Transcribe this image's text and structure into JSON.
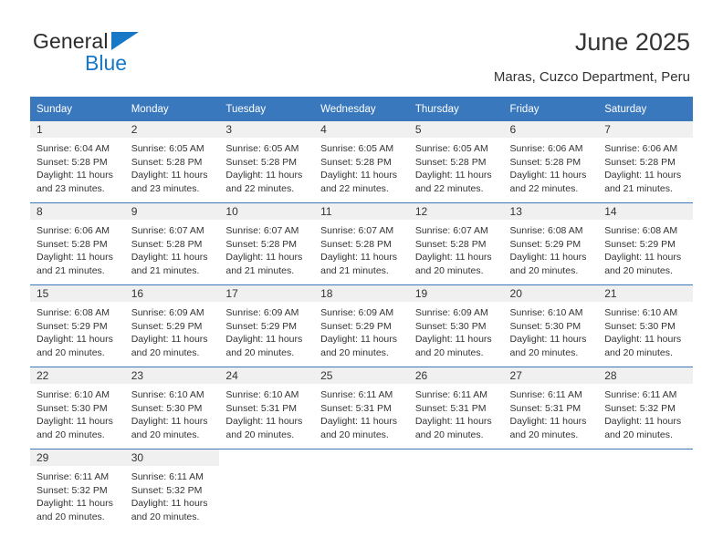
{
  "brand": {
    "name_top": "General",
    "name_bottom": "Blue",
    "color_blue": "#1878c8",
    "color_dark": "#2b2b2b",
    "triangle_icon": "triangle-logo-icon"
  },
  "header": {
    "title": "June 2025",
    "subtitle": "Maras, Cuzco Department, Peru"
  },
  "theme": {
    "header_bg": "#3a78bd",
    "header_text": "#ffffff",
    "daynum_bg": "#f0f0f0",
    "body_text": "#333333"
  },
  "calendar": {
    "weekday_headers": [
      "Sunday",
      "Monday",
      "Tuesday",
      "Wednesday",
      "Thursday",
      "Friday",
      "Saturday"
    ],
    "weeks": [
      [
        {
          "day": "1",
          "sunrise": "Sunrise: 6:04 AM",
          "sunset": "Sunset: 5:28 PM",
          "daylight_l1": "Daylight: 11 hours",
          "daylight_l2": "and 23 minutes."
        },
        {
          "day": "2",
          "sunrise": "Sunrise: 6:05 AM",
          "sunset": "Sunset: 5:28 PM",
          "daylight_l1": "Daylight: 11 hours",
          "daylight_l2": "and 23 minutes."
        },
        {
          "day": "3",
          "sunrise": "Sunrise: 6:05 AM",
          "sunset": "Sunset: 5:28 PM",
          "daylight_l1": "Daylight: 11 hours",
          "daylight_l2": "and 22 minutes."
        },
        {
          "day": "4",
          "sunrise": "Sunrise: 6:05 AM",
          "sunset": "Sunset: 5:28 PM",
          "daylight_l1": "Daylight: 11 hours",
          "daylight_l2": "and 22 minutes."
        },
        {
          "day": "5",
          "sunrise": "Sunrise: 6:05 AM",
          "sunset": "Sunset: 5:28 PM",
          "daylight_l1": "Daylight: 11 hours",
          "daylight_l2": "and 22 minutes."
        },
        {
          "day": "6",
          "sunrise": "Sunrise: 6:06 AM",
          "sunset": "Sunset: 5:28 PM",
          "daylight_l1": "Daylight: 11 hours",
          "daylight_l2": "and 22 minutes."
        },
        {
          "day": "7",
          "sunrise": "Sunrise: 6:06 AM",
          "sunset": "Sunset: 5:28 PM",
          "daylight_l1": "Daylight: 11 hours",
          "daylight_l2": "and 21 minutes."
        }
      ],
      [
        {
          "day": "8",
          "sunrise": "Sunrise: 6:06 AM",
          "sunset": "Sunset: 5:28 PM",
          "daylight_l1": "Daylight: 11 hours",
          "daylight_l2": "and 21 minutes."
        },
        {
          "day": "9",
          "sunrise": "Sunrise: 6:07 AM",
          "sunset": "Sunset: 5:28 PM",
          "daylight_l1": "Daylight: 11 hours",
          "daylight_l2": "and 21 minutes."
        },
        {
          "day": "10",
          "sunrise": "Sunrise: 6:07 AM",
          "sunset": "Sunset: 5:28 PM",
          "daylight_l1": "Daylight: 11 hours",
          "daylight_l2": "and 21 minutes."
        },
        {
          "day": "11",
          "sunrise": "Sunrise: 6:07 AM",
          "sunset": "Sunset: 5:28 PM",
          "daylight_l1": "Daylight: 11 hours",
          "daylight_l2": "and 21 minutes."
        },
        {
          "day": "12",
          "sunrise": "Sunrise: 6:07 AM",
          "sunset": "Sunset: 5:28 PM",
          "daylight_l1": "Daylight: 11 hours",
          "daylight_l2": "and 20 minutes."
        },
        {
          "day": "13",
          "sunrise": "Sunrise: 6:08 AM",
          "sunset": "Sunset: 5:29 PM",
          "daylight_l1": "Daylight: 11 hours",
          "daylight_l2": "and 20 minutes."
        },
        {
          "day": "14",
          "sunrise": "Sunrise: 6:08 AM",
          "sunset": "Sunset: 5:29 PM",
          "daylight_l1": "Daylight: 11 hours",
          "daylight_l2": "and 20 minutes."
        }
      ],
      [
        {
          "day": "15",
          "sunrise": "Sunrise: 6:08 AM",
          "sunset": "Sunset: 5:29 PM",
          "daylight_l1": "Daylight: 11 hours",
          "daylight_l2": "and 20 minutes."
        },
        {
          "day": "16",
          "sunrise": "Sunrise: 6:09 AM",
          "sunset": "Sunset: 5:29 PM",
          "daylight_l1": "Daylight: 11 hours",
          "daylight_l2": "and 20 minutes."
        },
        {
          "day": "17",
          "sunrise": "Sunrise: 6:09 AM",
          "sunset": "Sunset: 5:29 PM",
          "daylight_l1": "Daylight: 11 hours",
          "daylight_l2": "and 20 minutes."
        },
        {
          "day": "18",
          "sunrise": "Sunrise: 6:09 AM",
          "sunset": "Sunset: 5:29 PM",
          "daylight_l1": "Daylight: 11 hours",
          "daylight_l2": "and 20 minutes."
        },
        {
          "day": "19",
          "sunrise": "Sunrise: 6:09 AM",
          "sunset": "Sunset: 5:30 PM",
          "daylight_l1": "Daylight: 11 hours",
          "daylight_l2": "and 20 minutes."
        },
        {
          "day": "20",
          "sunrise": "Sunrise: 6:10 AM",
          "sunset": "Sunset: 5:30 PM",
          "daylight_l1": "Daylight: 11 hours",
          "daylight_l2": "and 20 minutes."
        },
        {
          "day": "21",
          "sunrise": "Sunrise: 6:10 AM",
          "sunset": "Sunset: 5:30 PM",
          "daylight_l1": "Daylight: 11 hours",
          "daylight_l2": "and 20 minutes."
        }
      ],
      [
        {
          "day": "22",
          "sunrise": "Sunrise: 6:10 AM",
          "sunset": "Sunset: 5:30 PM",
          "daylight_l1": "Daylight: 11 hours",
          "daylight_l2": "and 20 minutes."
        },
        {
          "day": "23",
          "sunrise": "Sunrise: 6:10 AM",
          "sunset": "Sunset: 5:30 PM",
          "daylight_l1": "Daylight: 11 hours",
          "daylight_l2": "and 20 minutes."
        },
        {
          "day": "24",
          "sunrise": "Sunrise: 6:10 AM",
          "sunset": "Sunset: 5:31 PM",
          "daylight_l1": "Daylight: 11 hours",
          "daylight_l2": "and 20 minutes."
        },
        {
          "day": "25",
          "sunrise": "Sunrise: 6:11 AM",
          "sunset": "Sunset: 5:31 PM",
          "daylight_l1": "Daylight: 11 hours",
          "daylight_l2": "and 20 minutes."
        },
        {
          "day": "26",
          "sunrise": "Sunrise: 6:11 AM",
          "sunset": "Sunset: 5:31 PM",
          "daylight_l1": "Daylight: 11 hours",
          "daylight_l2": "and 20 minutes."
        },
        {
          "day": "27",
          "sunrise": "Sunrise: 6:11 AM",
          "sunset": "Sunset: 5:31 PM",
          "daylight_l1": "Daylight: 11 hours",
          "daylight_l2": "and 20 minutes."
        },
        {
          "day": "28",
          "sunrise": "Sunrise: 6:11 AM",
          "sunset": "Sunset: 5:32 PM",
          "daylight_l1": "Daylight: 11 hours",
          "daylight_l2": "and 20 minutes."
        }
      ],
      [
        {
          "day": "29",
          "sunrise": "Sunrise: 6:11 AM",
          "sunset": "Sunset: 5:32 PM",
          "daylight_l1": "Daylight: 11 hours",
          "daylight_l2": "and 20 minutes."
        },
        {
          "day": "30",
          "sunrise": "Sunrise: 6:11 AM",
          "sunset": "Sunset: 5:32 PM",
          "daylight_l1": "Daylight: 11 hours",
          "daylight_l2": "and 20 minutes."
        },
        {
          "day": "",
          "sunrise": "",
          "sunset": "",
          "daylight_l1": "",
          "daylight_l2": ""
        },
        {
          "day": "",
          "sunrise": "",
          "sunset": "",
          "daylight_l1": "",
          "daylight_l2": ""
        },
        {
          "day": "",
          "sunrise": "",
          "sunset": "",
          "daylight_l1": "",
          "daylight_l2": ""
        },
        {
          "day": "",
          "sunrise": "",
          "sunset": "",
          "daylight_l1": "",
          "daylight_l2": ""
        },
        {
          "day": "",
          "sunrise": "",
          "sunset": "",
          "daylight_l1": "",
          "daylight_l2": ""
        }
      ]
    ]
  }
}
